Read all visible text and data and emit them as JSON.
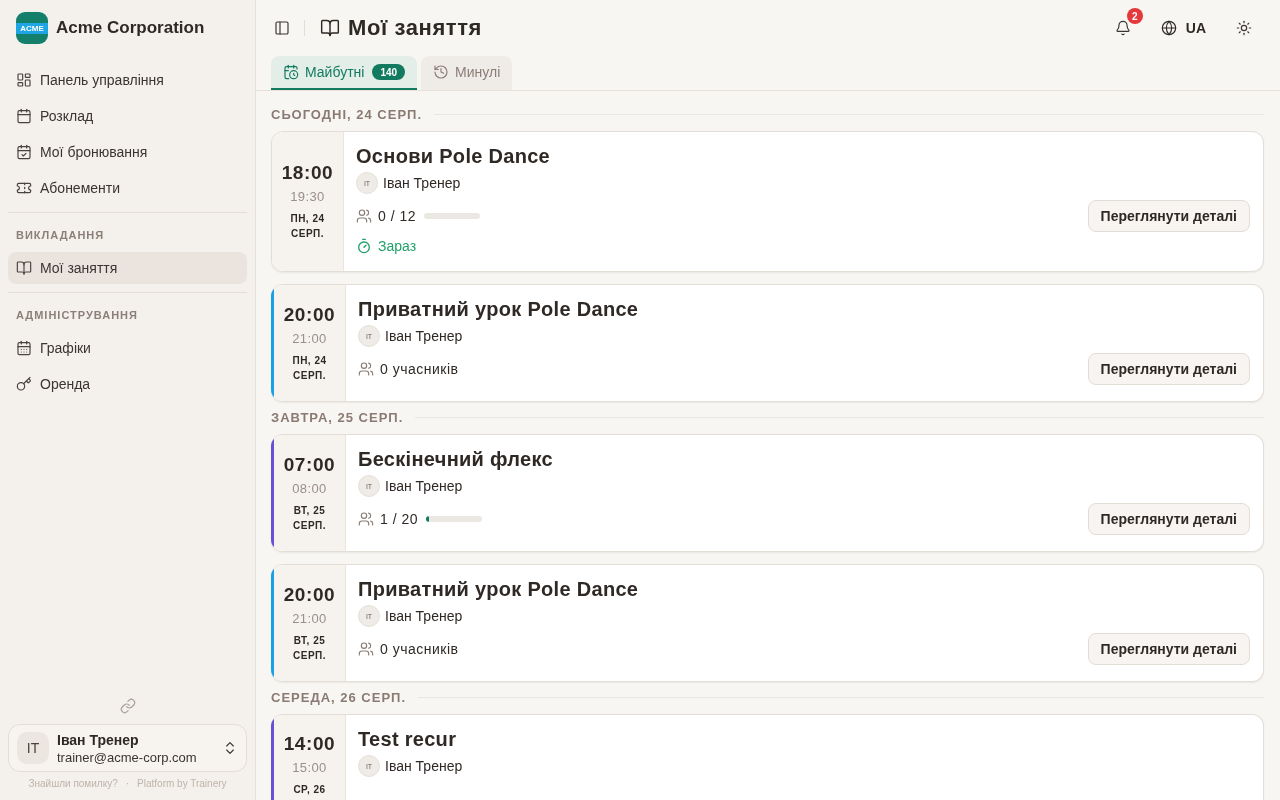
{
  "sidebar": {
    "brand": {
      "logo_text": "ACME",
      "name": "Acme Corporation"
    },
    "groups": [
      {
        "items": [
          {
            "label": "Панель управління",
            "selected": false
          },
          {
            "label": "Розклад",
            "selected": false
          },
          {
            "label": "Мої бронювання",
            "selected": false
          },
          {
            "label": "Абонементи",
            "selected": false
          }
        ]
      },
      {
        "heading": "ВИКЛАДАННЯ",
        "items": [
          {
            "label": "Мої заняття",
            "selected": true
          }
        ]
      },
      {
        "heading": "АДМІНІСТРУВАННЯ",
        "items": [
          {
            "label": "Графіки",
            "selected": false
          },
          {
            "label": "Оренда",
            "selected": false
          }
        ]
      }
    ],
    "user": {
      "initials": "IT",
      "name": "Іван Тренер",
      "email": "trainer@acme-corp.com"
    },
    "footer": {
      "report_link": "Знайшли помилку?",
      "separator": "·",
      "platform_link": "Platform by Trainery"
    }
  },
  "header": {
    "title": "Мої заняття",
    "notifications": "2",
    "language": "UA"
  },
  "tabs": [
    {
      "label": "Майбутні",
      "count": "140",
      "selected": true
    },
    {
      "label": "Минулі",
      "selected": false
    }
  ],
  "schedule": [
    {
      "heading": "СЬОГОДНІ, 24 СЕРП.",
      "classes": [
        {
          "start": "18:00",
          "end": "19:30",
          "date": "ПН, 24 СЕРП.",
          "title": "Основи Pole Dance",
          "trainer": {
            "initials": "IT",
            "name": "Іван Тренер"
          },
          "attendance": {
            "kind": "capacity",
            "text": "0 / 12"
          },
          "status": "Зараз",
          "button": "Переглянути деталі"
        },
        {
          "color": "#1a9fe0",
          "start": "20:00",
          "end": "21:00",
          "date": "ПН, 24 СЕРП.",
          "title": "Приватний урок Pole Dance",
          "trainer": {
            "initials": "IT",
            "name": "Іван Тренер"
          },
          "attendance": {
            "kind": "count",
            "text": "0 учасників"
          },
          "button": "Переглянути деталі"
        }
      ]
    },
    {
      "heading": "ЗАВТРА, 25 СЕРП.",
      "classes": [
        {
          "color": "#6a4fd4",
          "start": "07:00",
          "end": "08:00",
          "date": "ВТ, 25 СЕРП.",
          "title": "Бескінечний флекс",
          "trainer": {
            "initials": "IT",
            "name": "Іван Тренер"
          },
          "attendance": {
            "kind": "capacity",
            "text": "1 / 20",
            "level": 0.05
          },
          "button": "Переглянути деталі"
        },
        {
          "color": "#1a9fe0",
          "start": "20:00",
          "end": "21:00",
          "date": "ВТ, 25 СЕРП.",
          "title": "Приватний урок Pole Dance",
          "trainer": {
            "initials": "IT",
            "name": "Іван Тренер"
          },
          "attendance": {
            "kind": "count",
            "text": "0 учасників"
          },
          "button": "Переглянути деталі"
        }
      ]
    },
    {
      "heading": "СЕРЕДА, 26 СЕРП.",
      "classes": [
        {
          "color": "#6a4fd4",
          "start": "14:00",
          "end": "15:00",
          "date": "СР, 26",
          "title": "Test recur",
          "trainer": {
            "initials": "IT",
            "name": "Іван Тренер"
          }
        }
      ]
    }
  ]
}
